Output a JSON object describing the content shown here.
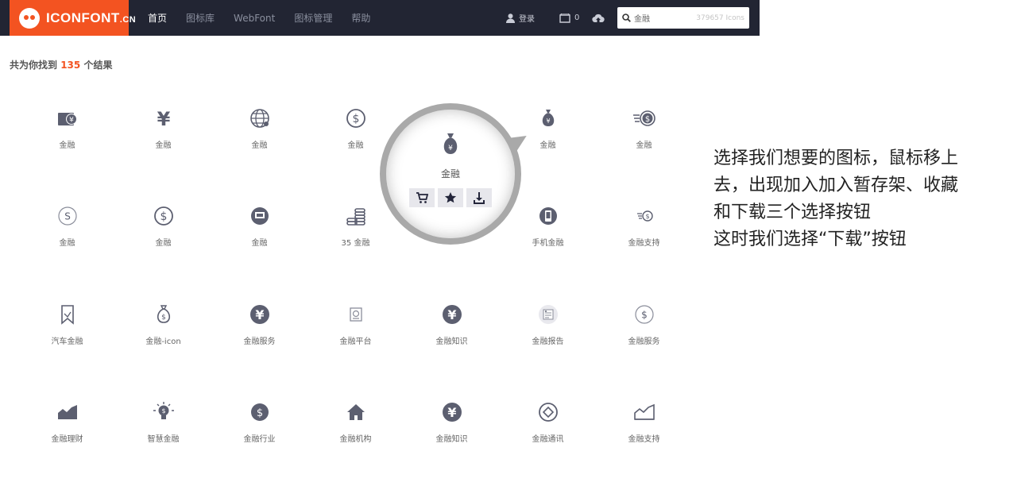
{
  "header": {
    "logo_text": "ICONFONT",
    "logo_suffix": ".CN",
    "nav": [
      "首页",
      "图标库",
      "WebFont",
      "图标管理",
      "帮助"
    ],
    "login_label": "登录",
    "cart_count": "0",
    "search": {
      "value": "金融",
      "count": "379657 Icons"
    }
  },
  "results": {
    "prefix": "共为你找到",
    "count": "135",
    "suffix": "个结果"
  },
  "icons": [
    "金融",
    "金融",
    "金融",
    "金融",
    "金融",
    "金融",
    "金融",
    "金融",
    "金融",
    "金融",
    "35 金融",
    "金融",
    "手机金融",
    "金融支持",
    "汽车金融",
    "金融-icon",
    "金融服务",
    "金融平台",
    "金融知识",
    "金融报告",
    "金融服务",
    "金融理财",
    "智慧金融",
    "金融行业",
    "金融机构",
    "金融知识",
    "金融通讯",
    "金融支持"
  ],
  "hover_popup": {
    "label": "金融",
    "actions": [
      "cart-icon",
      "star-icon",
      "download-icon"
    ]
  },
  "instruction": {
    "lines": [
      "选择我们想要的图标，鼠标移上",
      "去，出现加入加入暂存架、收藏",
      "和下载三个选择按钮",
      "这时我们选择“下载”按钮"
    ]
  },
  "colors": {
    "brand": "#f35321",
    "header_bg": "#222533",
    "icon": "#5c5f70"
  }
}
